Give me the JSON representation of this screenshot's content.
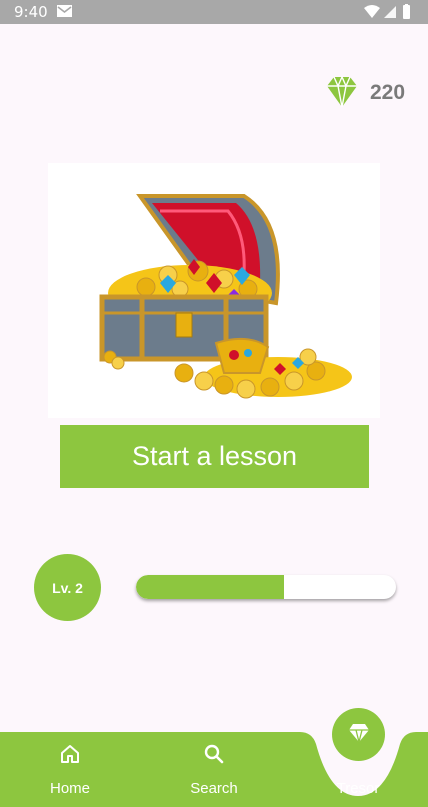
{
  "status_bar": {
    "time": "9:40",
    "icons": [
      "mail-icon",
      "wifi-icon",
      "signal-icon",
      "battery-icon"
    ],
    "background": "#a8a8a8"
  },
  "gems": {
    "count": "220",
    "icon": "gem-icon",
    "color": "#8dc63f"
  },
  "treasure": {
    "icon": "treasure-chest-illustration"
  },
  "lesson": {
    "start_label": "Start a lesson"
  },
  "level": {
    "label": "Lv. 2",
    "progress": 0.57
  },
  "nav": {
    "items": [
      {
        "label": "Home",
        "icon": "home-icon"
      },
      {
        "label": "Search",
        "icon": "search-icon"
      },
      {
        "label": "Tresor",
        "icon": "gem-icon"
      }
    ],
    "active": "Tresor"
  },
  "colors": {
    "accent": "#8dc63f",
    "background": "#fdf7fc",
    "text_muted": "#7a7a7a"
  }
}
